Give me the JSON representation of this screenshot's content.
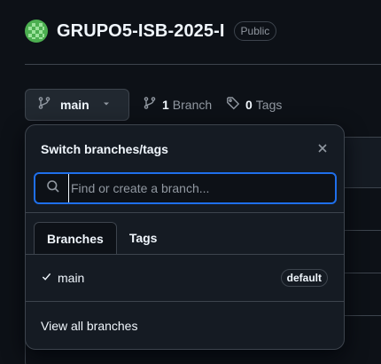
{
  "repo": {
    "name": "GRUPO5-ISB-2025-I",
    "visibility": "Public"
  },
  "toolbar": {
    "branch_label": "main",
    "branch_count": "1",
    "branch_word": "Branch",
    "tag_count": "0",
    "tag_word": "Tags"
  },
  "dropdown": {
    "title": "Switch branches/tags",
    "search_placeholder": "Find or create a branch...",
    "tabs": [
      {
        "label": "Branches",
        "active": true
      },
      {
        "label": "Tags",
        "active": false
      }
    ],
    "branches": [
      {
        "name": "main",
        "checked": true,
        "badge": "default"
      }
    ],
    "view_all_label": "View all branches"
  },
  "colors": {
    "background": "#0d1117",
    "panel": "#151b23",
    "border": "#3d444d",
    "focus": "#1f6feb",
    "text": "#f0f6fc",
    "muted": "#9198a1"
  },
  "icons": {
    "avatar": "identicon-avatar",
    "branch": "git-branch-icon",
    "tag": "tag-icon",
    "close": "close-icon",
    "search": "search-icon",
    "check": "check-icon",
    "caret": "caret-down-icon"
  }
}
